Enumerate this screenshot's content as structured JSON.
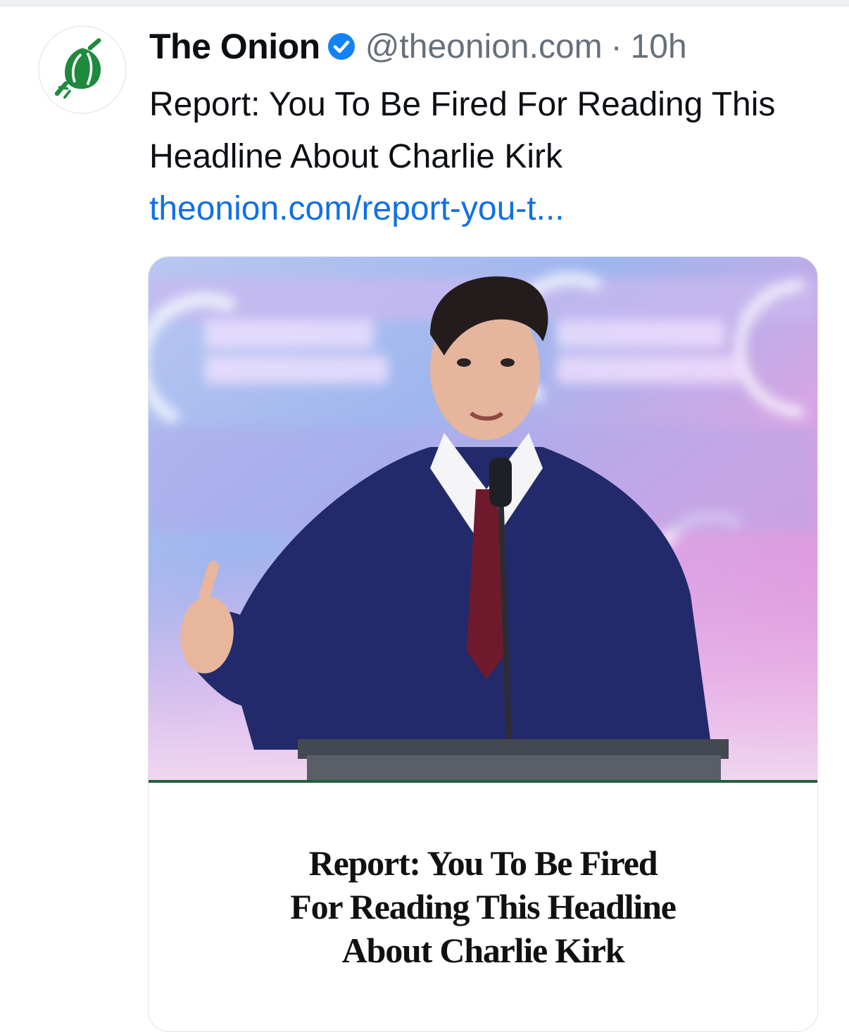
{
  "post": {
    "author_name": "The Onion",
    "verified_icon": "verified-check-icon",
    "handle": "@theonion.com",
    "separator": "·",
    "timestamp": "10h",
    "text": "Report: You To Be Fired For Reading This Headline About Charlie Kirk",
    "link_text": "theonion.com/report-you-t..."
  },
  "avatar": {
    "icon": "onion-logo-icon",
    "color": "#1e8a3e"
  },
  "card": {
    "image_description_icon": "speaker-at-podium-photo",
    "headline_lines": [
      "Report: You To Be Fired",
      "For Reading This Headline",
      "About Charlie Kirk"
    ],
    "accent_color": "#245e3f"
  },
  "colors": {
    "link": "#1170e6",
    "verified": "#1183f5",
    "muted": "#66707b",
    "text": "#0b0f14"
  }
}
